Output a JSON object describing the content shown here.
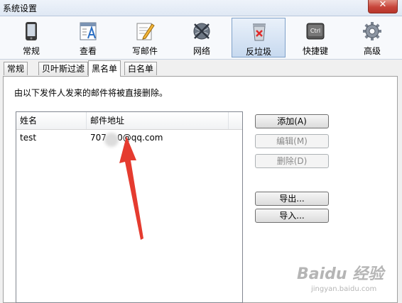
{
  "window": {
    "title": "系统设置",
    "close_glyph": "✕"
  },
  "toolbar": {
    "items": [
      {
        "label": "常规",
        "icon": "phone-icon"
      },
      {
        "label": "查看",
        "icon": "view-icon"
      },
      {
        "label": "写邮件",
        "icon": "compose-icon"
      },
      {
        "label": "网络",
        "icon": "globe-icon"
      },
      {
        "label": "反垃圾",
        "icon": "trash-icon",
        "active": true
      },
      {
        "label": "快捷键",
        "icon": "ctrl-key-icon",
        "key_text": "Ctrl"
      },
      {
        "label": "高级",
        "icon": "gear-icon"
      }
    ]
  },
  "tabs": [
    {
      "label": "常规"
    },
    {
      "label": "贝叶斯过滤"
    },
    {
      "label": "黑名单",
      "active": true
    },
    {
      "label": "白名单"
    }
  ],
  "blacklist": {
    "description": "由以下发件人发来的邮件将被直接删除。",
    "columns": [
      "姓名",
      "邮件地址"
    ],
    "rows": [
      {
        "name": "test",
        "email": "707    0@qq.com"
      }
    ],
    "buttons": {
      "add": "添加(A)",
      "edit": "编辑(M)",
      "delete": "删除(D)",
      "export": "导出...",
      "import": "导入..."
    }
  },
  "watermark": {
    "main": "Baidu 经验",
    "sub": "jingyan.baidu.com"
  },
  "colors": {
    "arrow": "#e53b2f",
    "active_tab_bg": "#c7d9ef"
  }
}
